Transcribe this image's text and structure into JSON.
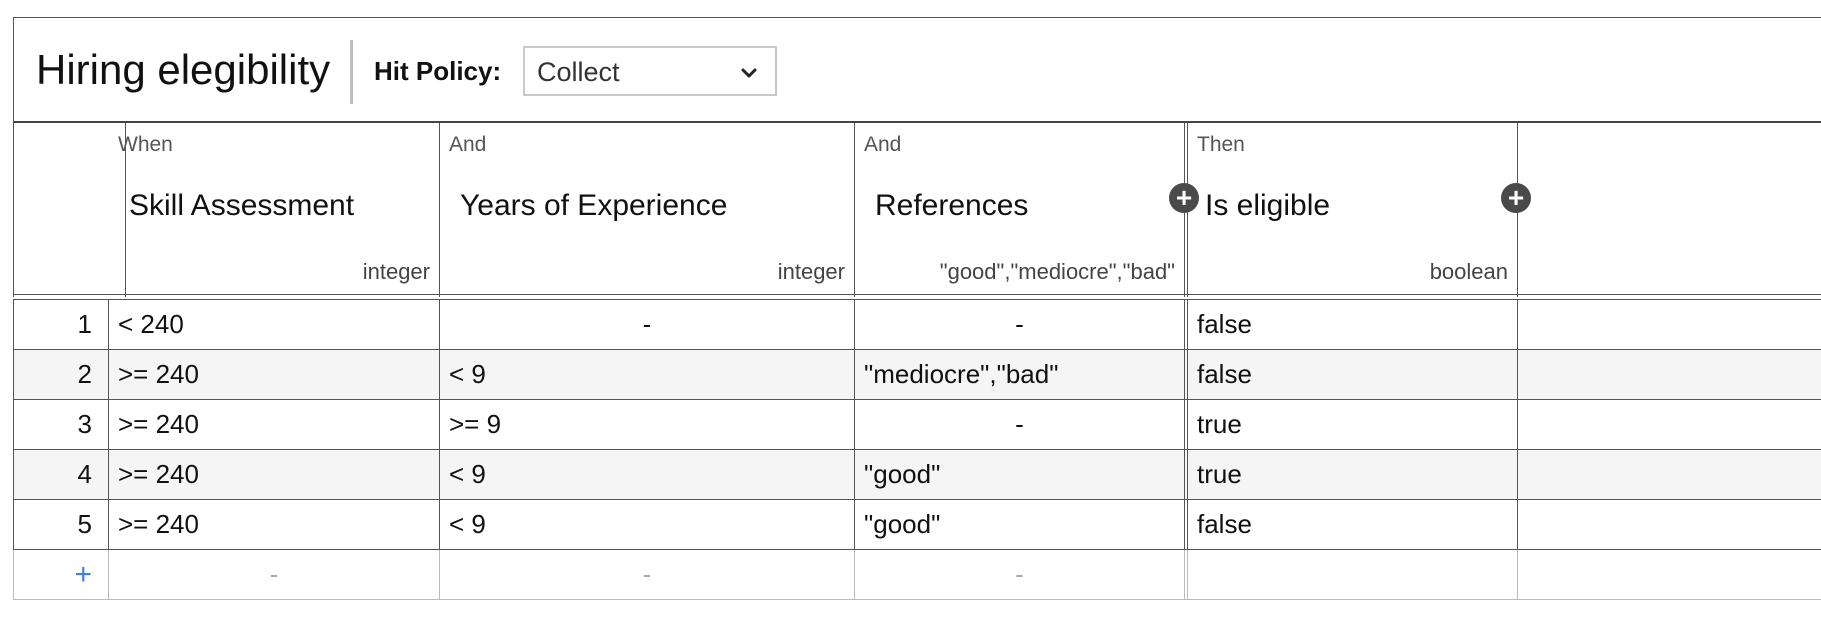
{
  "table": {
    "title": "Hiring elegibility",
    "hit_policy_label": "Hit Policy:",
    "hit_policy_value": "Collect",
    "columns": [
      {
        "keyword": "When",
        "name": "Skill Assessment",
        "type": "integer"
      },
      {
        "keyword": "And",
        "name": "Years of Experience",
        "type": "integer"
      },
      {
        "keyword": "And",
        "name": "References",
        "type": "\"good\",\"mediocre\",\"bad\""
      },
      {
        "keyword": "Then",
        "name": "Is eligible",
        "type": "boolean"
      }
    ],
    "rows": [
      {
        "num": "1",
        "cells": [
          "< 240",
          "-",
          "-",
          "false"
        ]
      },
      {
        "num": "2",
        "cells": [
          ">= 240",
          "< 9",
          "\"mediocre\",\"bad\"",
          "false"
        ]
      },
      {
        "num": "3",
        "cells": [
          ">= 240",
          ">= 9",
          "-",
          "true"
        ]
      },
      {
        "num": "4",
        "cells": [
          ">= 240",
          "< 9",
          "\"good\"",
          "true"
        ]
      },
      {
        "num": "5",
        "cells": [
          ">= 240",
          "< 9",
          "\"good\"",
          "false"
        ]
      }
    ],
    "add_row": {
      "symbol": "+",
      "placeholders": [
        "-",
        "-",
        "-",
        ""
      ]
    },
    "add_column_symbol": "+"
  },
  "icons": {
    "hit_policy_dropdown": "chevron-down-icon",
    "add_input_column": "plus-circle-icon",
    "add_output_column": "plus-circle-icon"
  },
  "colors": {
    "add_row_plus": "#3f7fe0",
    "add_column_button": "#4a4a4a",
    "alt_row": "#f5f5f5"
  }
}
